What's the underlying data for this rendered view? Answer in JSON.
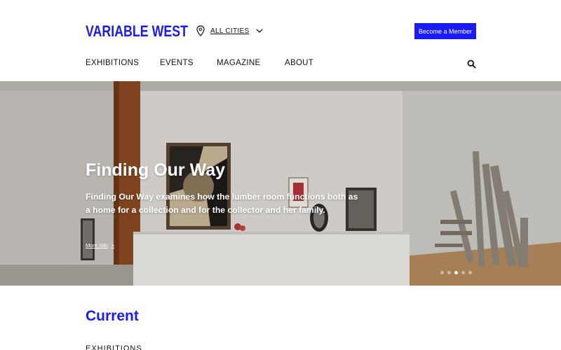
{
  "brand": {
    "logo_text": "VARIABLE WEST",
    "accent": "#1a1aff"
  },
  "location": {
    "label": "ALL CITIES",
    "icon": "map-pin-icon",
    "chevron": "chevron-down-icon"
  },
  "member_button": {
    "label": "Become a Member"
  },
  "nav": {
    "items": [
      "EXHIBITIONS",
      "EVENTS",
      "MAGAZINE",
      "ABOUT"
    ],
    "search_icon": "search-icon"
  },
  "hero": {
    "title": "Finding Our Way",
    "description": "Finding Our Way examines how the lumber room functions both as a home for a collection and for the collector and her family.",
    "more_info": "More Info",
    "more_info_arrow": ">",
    "slide_count": 5,
    "active_slide": 3
  },
  "current": {
    "title": "Current",
    "subheading": "EXHIBITIONS"
  }
}
